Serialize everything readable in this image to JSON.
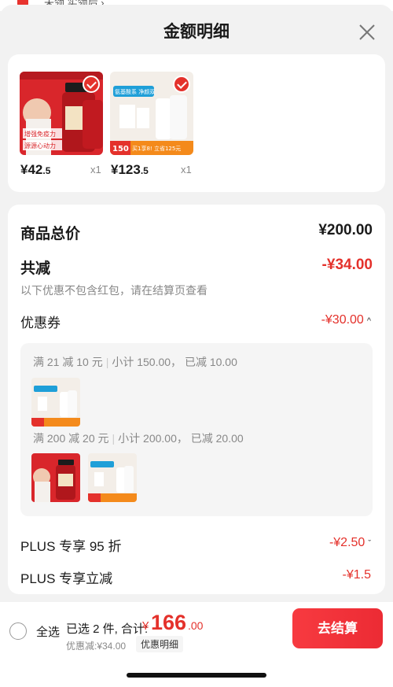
{
  "top_peek": {
    "text": "未领 实领后 ›"
  },
  "sheet": {
    "title": "金额明细"
  },
  "products": [
    {
      "price_int": "¥42",
      "price_dec": ".5",
      "qty": "x1",
      "image": "red-supplement-bottles",
      "image_text_1": "增强免疫力",
      "image_text_2": "源源心动力"
    },
    {
      "price_int": "¥123",
      "price_dec": ".5",
      "qty": "x1",
      "image": "skincare-cleanser-set",
      "image_text_1": "氨基酸系 净颜双",
      "image_text_2": "150",
      "image_text_3": "买1享8! 立省125元"
    }
  ],
  "detail": {
    "total_label": "商品总价",
    "total_value": "¥200.00",
    "reduce_label": "共减",
    "reduce_value": "-¥34.00",
    "reduce_note": "以下优惠不包含红包，请在结算页查看",
    "coupon_label": "优惠券",
    "coupon_value": "-¥30.00",
    "coupon_groups": [
      {
        "rule": "满 21 减 10 元",
        "subtotal": "小计 150.00， 已减 10.00"
      },
      {
        "rule": "满 200 减 20 元",
        "subtotal": "小计 200.00， 已减 20.00"
      }
    ],
    "plus_discount_label": "PLUS 专享 95 折",
    "plus_discount_value": "-¥2.50",
    "plus_reduce_label": "PLUS 专享立减",
    "plus_reduce_value": "-¥1.5"
  },
  "bottom": {
    "select_all": "全选",
    "selected_summary": "已选 2 件, 合计:",
    "currency": "¥",
    "total_int": "166",
    "total_dec": ".00",
    "discount_note": "优惠减:¥34.00",
    "detail_link": "优惠明细",
    "checkout": "去结算"
  },
  "colors": {
    "accent": "#e4312b",
    "background": "#f2f2f2"
  },
  "icons": {
    "close": "close-icon",
    "check": "check-badge-icon",
    "chevron_up": "chevron-up-icon",
    "chevron_down": "chevron-down-icon",
    "radio": "radio-unchecked-icon"
  }
}
